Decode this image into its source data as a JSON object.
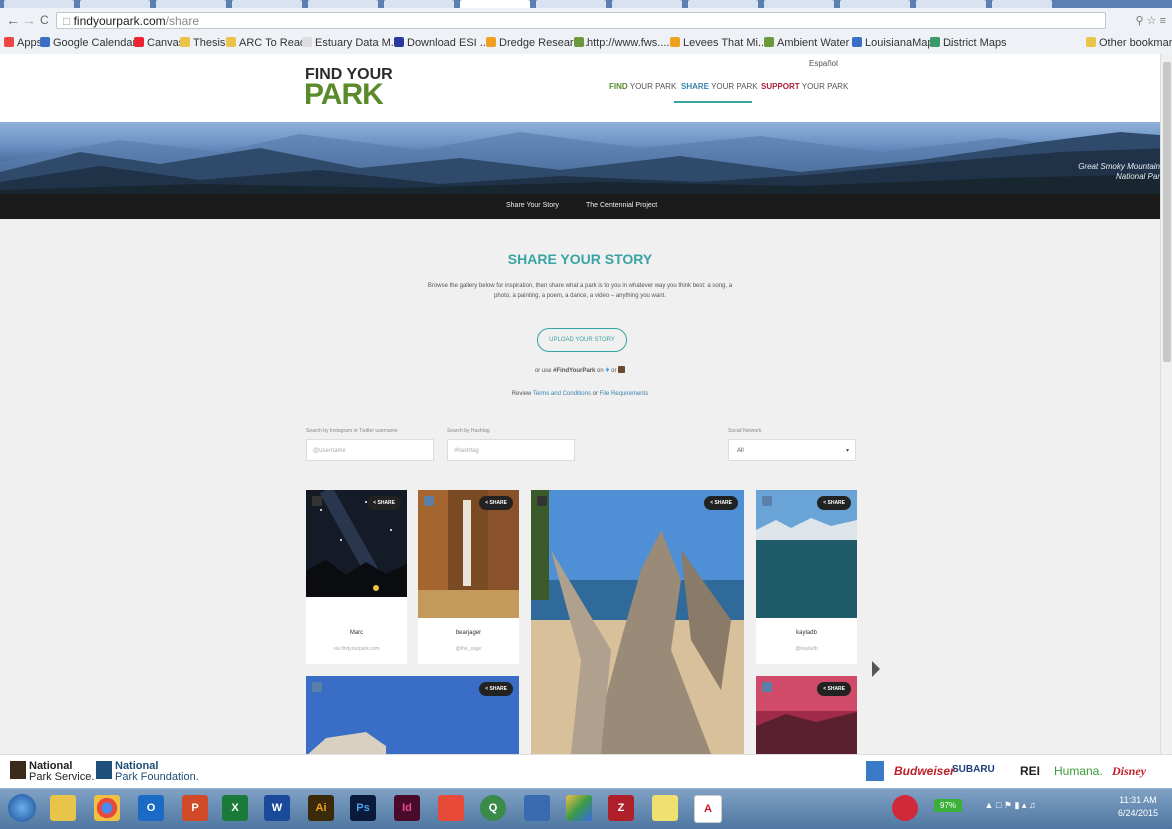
{
  "browser": {
    "url_host": "findyourpark.com",
    "url_path": "/share",
    "bookmarks": [
      {
        "label": "Apps",
        "color": "#e44"
      },
      {
        "label": "Google Calendar",
        "color": "#3a6fc6"
      },
      {
        "label": "Canvas",
        "color": "#e23"
      },
      {
        "label": "Thesis",
        "color": "#e8c44a"
      },
      {
        "label": "ARC To Read",
        "color": "#e8c44a"
      },
      {
        "label": "Estuary Data M...",
        "color": "#ddd"
      },
      {
        "label": "Download ESI ...",
        "color": "#2a3a9a"
      },
      {
        "label": "Dredge Researc...",
        "color": "#f0a020"
      },
      {
        "label": "http://www.fws....",
        "color": "#6a9a3a"
      },
      {
        "label": "Levees That Mi...",
        "color": "#f0a020"
      },
      {
        "label": "Ambient Water ...",
        "color": "#6a9a3a"
      },
      {
        "label": "LouisianaMap - ...",
        "color": "#3a6fc6"
      },
      {
        "label": "District Maps",
        "color": "#3a9a6a"
      }
    ],
    "other_bookmarks": "Other bookmarks"
  },
  "site": {
    "logo_top": "FIND YOUR",
    "logo_bottom": "PARK",
    "espanol": "Español",
    "nav": [
      {
        "bold": "FIND",
        "rest": " YOUR PARK",
        "color": "#5a8a2a"
      },
      {
        "bold": "SHARE",
        "rest": " YOUR PARK",
        "color": "#3a84b0"
      },
      {
        "bold": "SUPPORT",
        "rest": " YOUR PARK",
        "color": "#b0203a"
      }
    ],
    "hero_caption_1": "Great Smoky Mountains",
    "hero_caption_2": "National Park",
    "subnav": [
      "Share Your Story",
      "The Centennial Project"
    ]
  },
  "main": {
    "title": "SHARE YOUR STORY",
    "intro": "Browse the gallery below for inspiration, then share what a park is to you in whatever way you think best: a song, a photo, a painting, a poem, a dance, a video – anything you want.",
    "upload_label": "UPLOAD YOUR STORY",
    "hash_prefix": "or use ",
    "hashtag": "#FindYourPark",
    "hash_on": " on ",
    "hash_or": " or ",
    "review_prefix": "Review ",
    "terms": "Terms and Conditions",
    "review_or": " or ",
    "file_req": "File Requirements",
    "search_user_label": "Search by Instagram or Twitter username",
    "search_user_placeholder": "@username",
    "search_tag_label": "Search by Hashtag",
    "search_tag_placeholder": "#hashtag",
    "network_label": "Social Network",
    "network_value": "All"
  },
  "cards": [
    {
      "user": "Marc",
      "handle": "via findyourpark.com",
      "share": "< SHARE"
    },
    {
      "user": "bearjager",
      "handle": "@the_sage",
      "share": "< SHARE"
    },
    {
      "user": "",
      "handle": "",
      "share": "< SHARE"
    },
    {
      "user": "kayladb",
      "handle": "@kayladb",
      "share": "< SHARE"
    },
    {
      "user": "",
      "handle": "",
      "share": "< SHARE"
    },
    {
      "user": "",
      "handle": "",
      "share": "< SHARE"
    }
  ],
  "footer": {
    "nps1": "National",
    "nps2": "Park Service.",
    "npf1": "National",
    "npf2": "Park Foundation.",
    "sponsors": [
      {
        "name": "Budweiser",
        "color": "#c0202a"
      },
      {
        "name": "SUBARU",
        "color": "#1e3f7a"
      },
      {
        "name": "REI",
        "color": "#222"
      },
      {
        "name": "Humana.",
        "color": "#3a9a3a"
      },
      {
        "name": "Disney",
        "color": "#c0202a"
      }
    ]
  },
  "taskbar": {
    "battery": "97%",
    "time": "11:31 AM",
    "date": "6/24/2015",
    "apps": [
      "start",
      "explorer",
      "chrome",
      "outlook",
      "powerpoint",
      "excel",
      "word",
      "illustrator",
      "photoshop",
      "indesign",
      "git",
      "qgis",
      "arcgis",
      "drive",
      "zotero",
      "sticky-notes",
      "acrobat"
    ]
  }
}
